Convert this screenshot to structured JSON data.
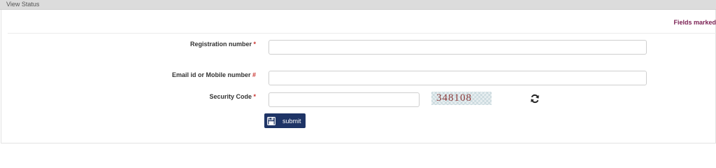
{
  "panel": {
    "title": "View Status"
  },
  "notice": {
    "text": "Fields marked"
  },
  "form": {
    "registration": {
      "label": "Registration number",
      "marker": "*",
      "value": ""
    },
    "email_mobile": {
      "label": "Email id or Mobile number",
      "marker": "#",
      "value": ""
    },
    "security": {
      "label": "Security Code",
      "marker": "*",
      "value": "",
      "captcha": "348108"
    }
  },
  "actions": {
    "submit_label": "submit"
  },
  "icons": {
    "submit": "floppy-disk-icon",
    "refresh": "refresh-icon"
  },
  "colors": {
    "button": "#1e3466",
    "required_marker": "#c9302c",
    "notice": "#7a1f52"
  }
}
